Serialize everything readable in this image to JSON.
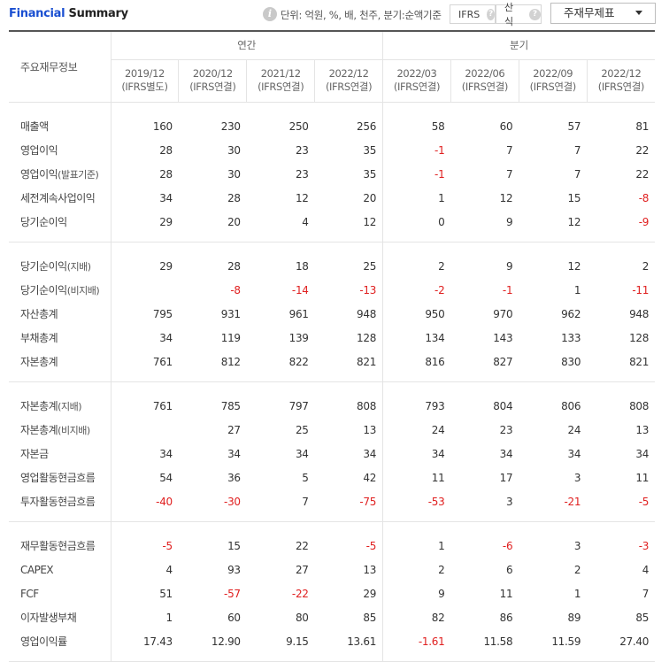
{
  "header": {
    "title_part1": "Financial",
    "title_part2": "Summary",
    "unit_text": "단위: 억원, %, 배, 천주, 분기:순액기준",
    "toggle_ifrs": "IFRS",
    "toggle_sansik": "산식",
    "help_mark": "?",
    "info_mark": "i",
    "select_value": "주재무제표"
  },
  "table": {
    "corner_label": "주요재무정보",
    "group_annual": "연간",
    "group_quarter": "분기",
    "periods": [
      {
        "date": "2019/12",
        "basis": "(IFRS별도)"
      },
      {
        "date": "2020/12",
        "basis": "(IFRS연결)"
      },
      {
        "date": "2021/12",
        "basis": "(IFRS연결)"
      },
      {
        "date": "2022/12",
        "basis": "(IFRS연결)"
      },
      {
        "date": "2022/03",
        "basis": "(IFRS연결)"
      },
      {
        "date": "2022/06",
        "basis": "(IFRS연결)"
      },
      {
        "date": "2022/09",
        "basis": "(IFRS연결)"
      },
      {
        "date": "2022/12",
        "basis": "(IFRS연결)"
      }
    ],
    "sections": [
      [
        {
          "label": "매출액",
          "sub": "",
          "values": [
            "160",
            "230",
            "250",
            "256",
            "58",
            "60",
            "57",
            "81"
          ]
        },
        {
          "label": "영업이익",
          "sub": "",
          "values": [
            "28",
            "30",
            "23",
            "35",
            "-1",
            "7",
            "7",
            "22"
          ]
        },
        {
          "label": "영업이익",
          "sub": "(발표기준)",
          "values": [
            "28",
            "30",
            "23",
            "35",
            "-1",
            "7",
            "7",
            "22"
          ]
        },
        {
          "label": "세전계속사업이익",
          "sub": "",
          "values": [
            "34",
            "28",
            "12",
            "20",
            "1",
            "12",
            "15",
            "-8"
          ]
        },
        {
          "label": "당기순이익",
          "sub": "",
          "values": [
            "29",
            "20",
            "4",
            "12",
            "0",
            "9",
            "12",
            "-9"
          ]
        }
      ],
      [
        {
          "label": "당기순이익",
          "sub": "(지배)",
          "values": [
            "29",
            "28",
            "18",
            "25",
            "2",
            "9",
            "12",
            "2"
          ]
        },
        {
          "label": "당기순이익",
          "sub": "(비지배)",
          "values": [
            "",
            "-8",
            "-14",
            "-13",
            "-2",
            "-1",
            "1",
            "-11"
          ]
        },
        {
          "label": "자산총계",
          "sub": "",
          "values": [
            "795",
            "931",
            "961",
            "948",
            "950",
            "970",
            "962",
            "948"
          ]
        },
        {
          "label": "부채총계",
          "sub": "",
          "values": [
            "34",
            "119",
            "139",
            "128",
            "134",
            "143",
            "133",
            "128"
          ]
        },
        {
          "label": "자본총계",
          "sub": "",
          "values": [
            "761",
            "812",
            "822",
            "821",
            "816",
            "827",
            "830",
            "821"
          ]
        }
      ],
      [
        {
          "label": "자본총계",
          "sub": "(지배)",
          "values": [
            "761",
            "785",
            "797",
            "808",
            "793",
            "804",
            "806",
            "808"
          ]
        },
        {
          "label": "자본총계",
          "sub": "(비지배)",
          "values": [
            "",
            "27",
            "25",
            "13",
            "24",
            "23",
            "24",
            "13"
          ]
        },
        {
          "label": "자본금",
          "sub": "",
          "values": [
            "34",
            "34",
            "34",
            "34",
            "34",
            "34",
            "34",
            "34"
          ]
        },
        {
          "label": "영업활동현금흐름",
          "sub": "",
          "values": [
            "54",
            "36",
            "5",
            "42",
            "11",
            "17",
            "3",
            "11"
          ]
        },
        {
          "label": "투자활동현금흐름",
          "sub": "",
          "values": [
            "-40",
            "-30",
            "7",
            "-75",
            "-53",
            "3",
            "-21",
            "-5"
          ]
        }
      ],
      [
        {
          "label": "재무활동현금흐름",
          "sub": "",
          "values": [
            "-5",
            "15",
            "22",
            "-5",
            "1",
            "-6",
            "3",
            "-3"
          ]
        },
        {
          "label": "CAPEX",
          "sub": "",
          "values": [
            "4",
            "93",
            "27",
            "13",
            "2",
            "6",
            "2",
            "4"
          ]
        },
        {
          "label": "FCF",
          "sub": "",
          "values": [
            "51",
            "-57",
            "-22",
            "29",
            "9",
            "11",
            "1",
            "7"
          ]
        },
        {
          "label": "이자발생부채",
          "sub": "",
          "values": [
            "1",
            "60",
            "80",
            "85",
            "82",
            "86",
            "89",
            "85"
          ]
        },
        {
          "label": "영업이익률",
          "sub": "",
          "values": [
            "17.43",
            "12.90",
            "9.15",
            "13.61",
            "-1.61",
            "11.58",
            "11.59",
            "27.40"
          ]
        }
      ]
    ]
  },
  "colors": {
    "title_blue": "#1a4fd1",
    "negative_red": "#e02020",
    "text": "#333333",
    "border": "#e4e4e4"
  }
}
